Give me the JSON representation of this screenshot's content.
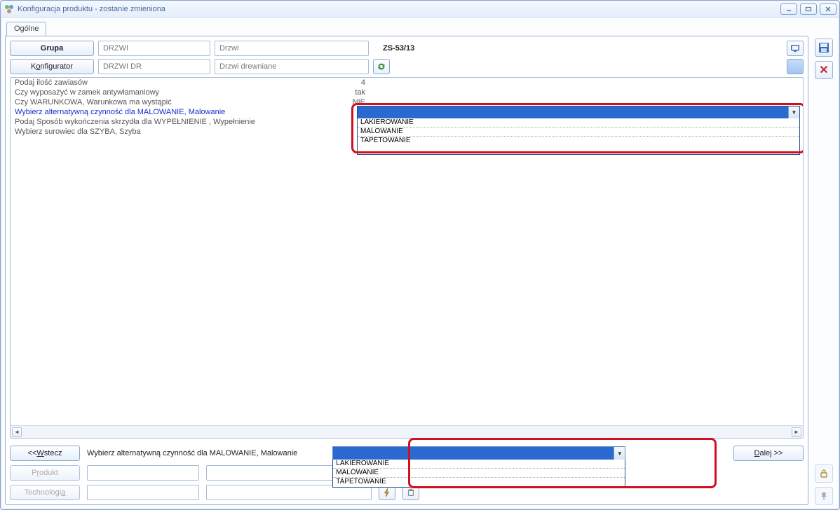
{
  "window": {
    "title": "Konfiguracja produktu - zostanie zmieniona"
  },
  "tab": {
    "label": "Ogólne"
  },
  "header": {
    "grupa_btn": "Grupa",
    "konfig_btn_pre": "K",
    "konfig_btn_u": "o",
    "konfig_btn_post": "nfigurator",
    "grupa_code": "DRZWI",
    "grupa_name": "Drzwi",
    "konfig_code": "DRZWI DR",
    "konfig_name": "Drzwi drewniane",
    "order_no": "ZS-53/13"
  },
  "list": {
    "lines": [
      {
        "q": "Podaj ilość zawiasów",
        "v": "4"
      },
      {
        "q": "Czy wyposażyć w zamek antywłamaniowy",
        "v": "tak"
      },
      {
        "q": "Czy WARUNKOWA, Warunkowa ma wystąpić",
        "v": "NIE"
      },
      {
        "q": "Wybierz alternatywną czynność dla MALOWANIE, Malowanie",
        "v": "",
        "active": true
      },
      {
        "q": "Podaj Sposób wykończenia skrzydła dla WYPEŁNIENIE , Wypełnienie",
        "v": ""
      },
      {
        "q": "Wybierz surowiec dla SZYBA, Szyba",
        "v": ""
      }
    ]
  },
  "dropdown": {
    "options": [
      "LAKIEROWANIE",
      "MALOWANIE",
      "TAPETOWANIE"
    ]
  },
  "footer": {
    "back_pre": "<< ",
    "back_u": "W",
    "back_post": "stecz",
    "next_pre": "",
    "next_u": "D",
    "next_post": "alej >>",
    "produkt_pre": "P",
    "produkt_u": "r",
    "produkt_post": "odukt",
    "tech_pre": "Technologi",
    "tech_u": "a",
    "tech_post": "",
    "prompt": "Wybierz alternatywną czynność dla MALOWANIE, Malowanie"
  }
}
